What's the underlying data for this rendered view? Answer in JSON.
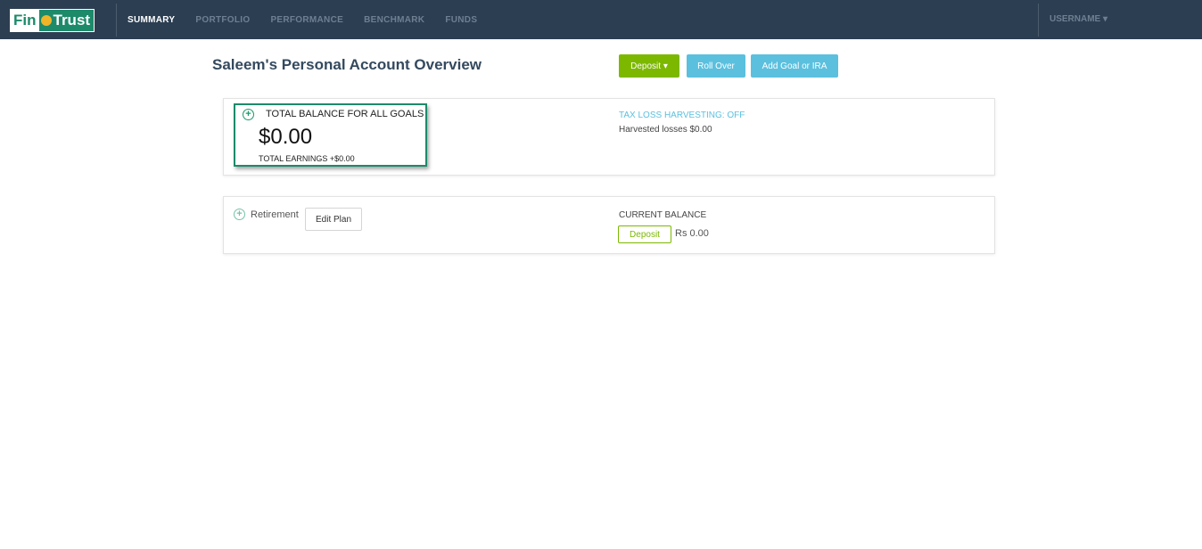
{
  "brand": {
    "logo_left": "Fin",
    "logo_right": "Trust"
  },
  "nav": {
    "items": [
      {
        "label": "SUMMARY",
        "active": true
      },
      {
        "label": "PORTFOLIO",
        "active": false
      },
      {
        "label": "PERFORMANCE",
        "active": false
      },
      {
        "label": "BENCHMARK",
        "active": false
      },
      {
        "label": "FUNDS",
        "active": false
      }
    ],
    "user_label": "USERNAME ▾"
  },
  "page": {
    "title": "Saleem's Personal Account Overview",
    "buttons": {
      "deposit": "Deposit ▾",
      "rollover": "Roll Over",
      "add_goal": "Add Goal or IRA"
    }
  },
  "summary": {
    "total_label": "TOTAL BALANCE FOR ALL GOALS",
    "total_amount": "$0.00",
    "total_earnings": "TOTAL EARNINGS +$0.00",
    "tax_loss": "TAX LOSS HARVESTING: OFF",
    "harvested": "Harvested losses $0.00"
  },
  "goal": {
    "name": "Retirement",
    "edit_label": "Edit Plan",
    "current_balance_label": "CURRENT BALANCE",
    "deposit_label": "Deposit",
    "balance": "Rs 0.00"
  },
  "colors": {
    "nav_bg": "#2c3e52",
    "brand": "#1d8a6a",
    "primary_green": "#7cb800",
    "info_blue": "#5bc0de"
  },
  "icons": {
    "goal_expand": "plus-circle-icon",
    "logo_mark": "coin-icon"
  }
}
